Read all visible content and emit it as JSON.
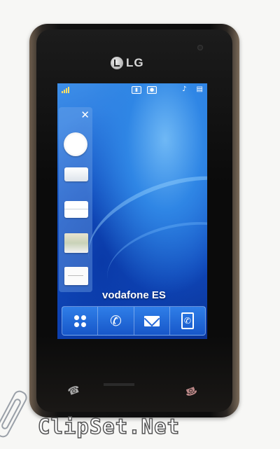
{
  "device": {
    "brand": "LG"
  },
  "status_bar": {
    "icons": [
      "signal-icon",
      "video-icon",
      "camera-icon",
      "music-icon",
      "battery-icon"
    ]
  },
  "shortcut_panel": {
    "close": "✕",
    "widgets": [
      "clock-widget",
      "calendar-widget",
      "notes-widget",
      "photo-widget",
      "memo-widget"
    ]
  },
  "home": {
    "operator": "vodafone ES"
  },
  "dock": {
    "items": [
      "menu-icon",
      "phone-icon",
      "message-icon",
      "contacts-icon"
    ]
  },
  "watermark": {
    "text": "ClipSet.Net"
  }
}
